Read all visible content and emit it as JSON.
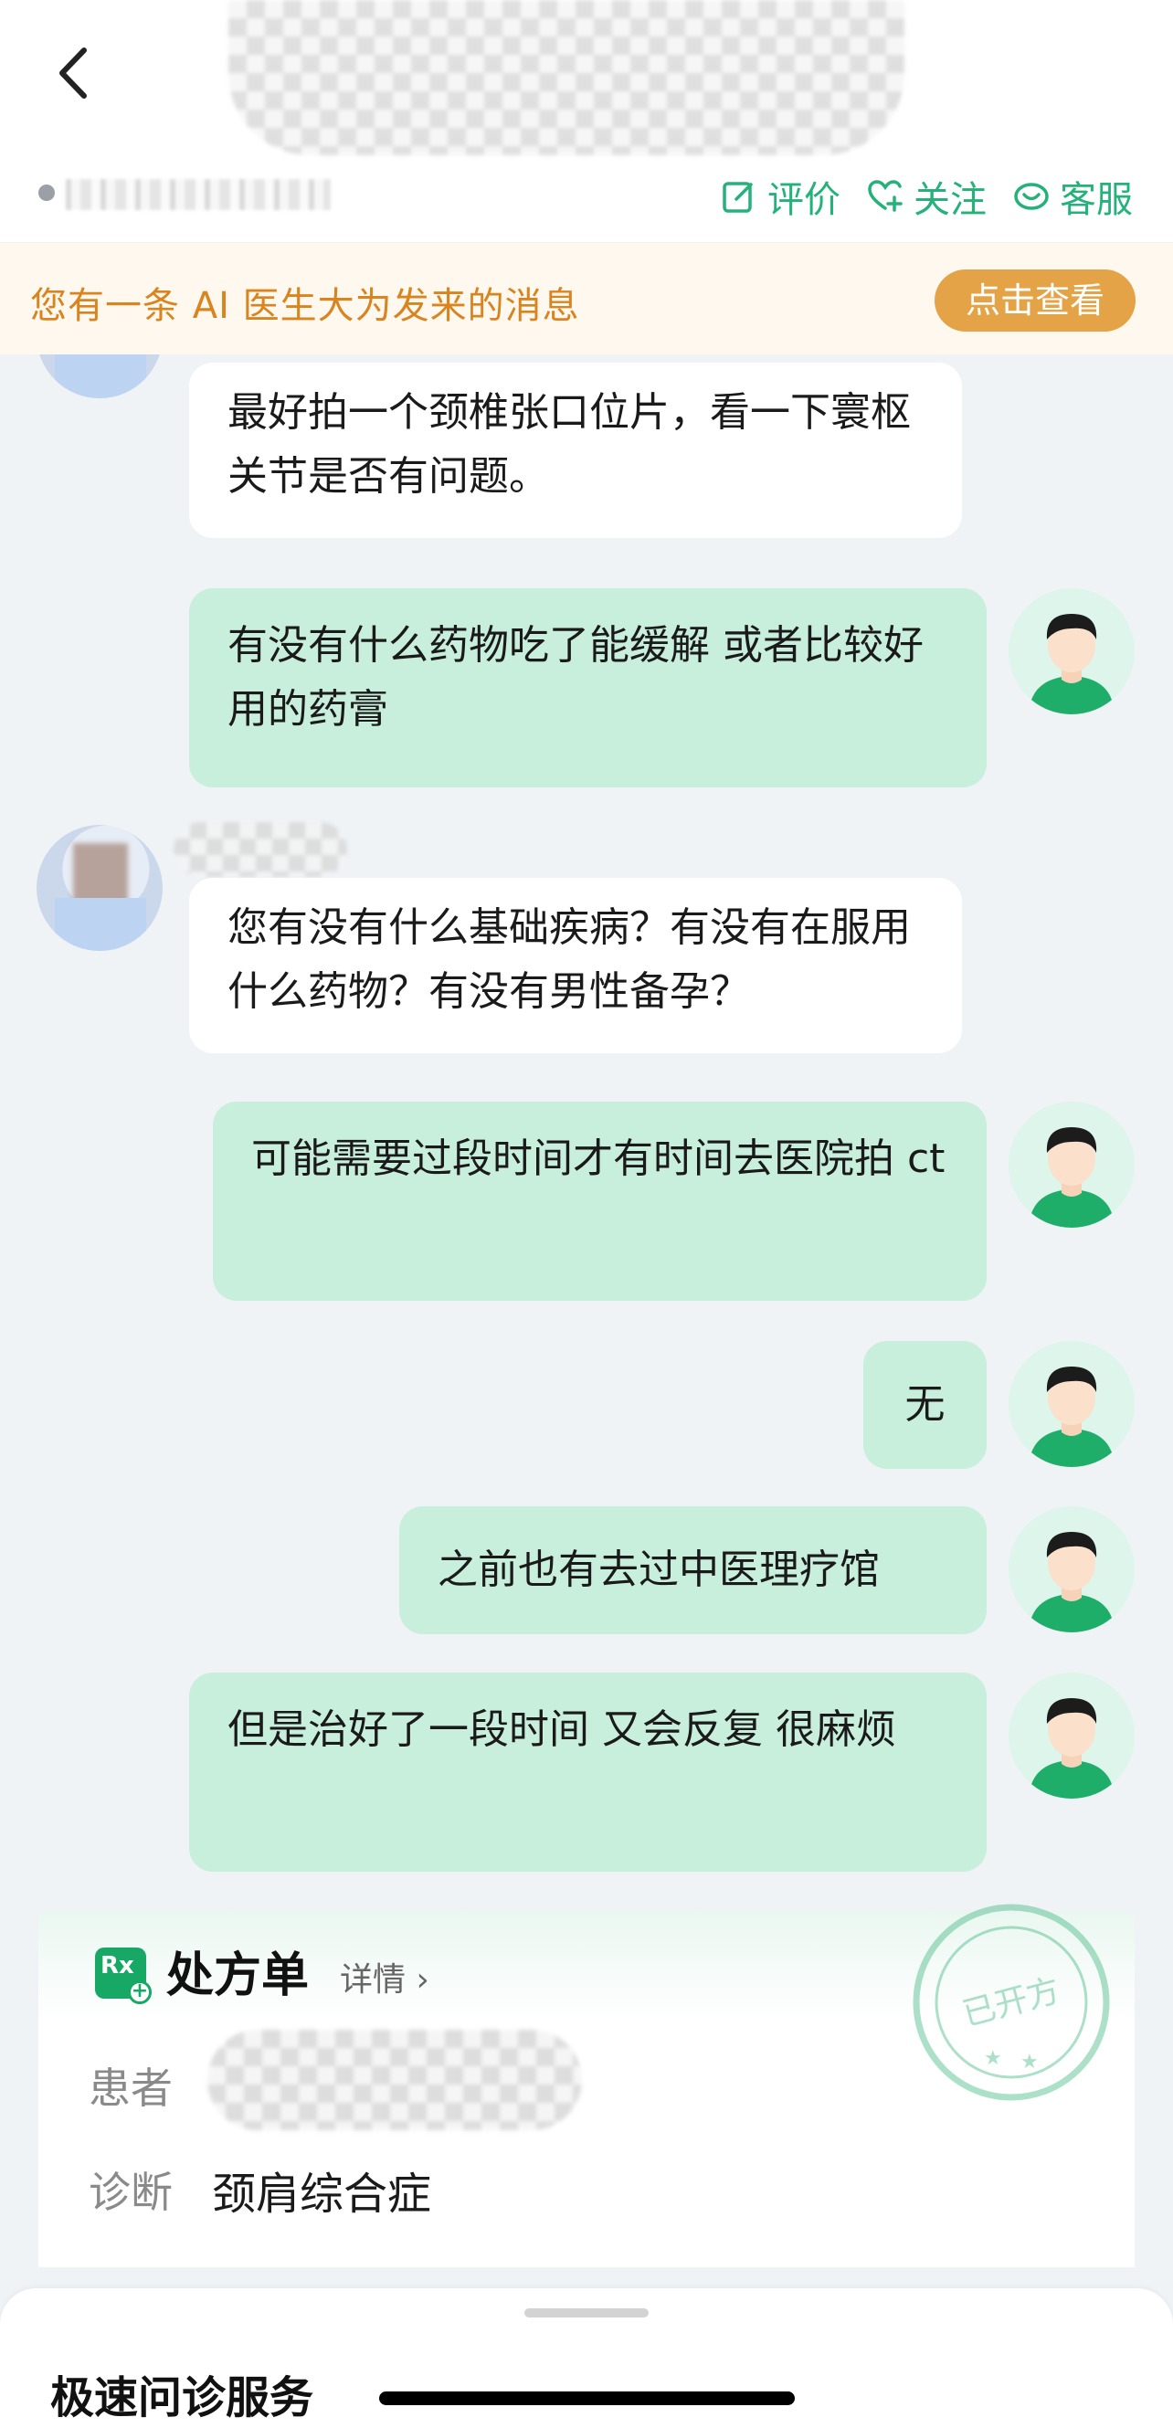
{
  "header": {
    "actions": [
      {
        "label": "评价",
        "icon": "edit-icon"
      },
      {
        "label": "关注",
        "icon": "heart-plus-icon"
      },
      {
        "label": "客服",
        "icon": "headset-icon"
      }
    ]
  },
  "notice": {
    "text": "您有一条 AI 医生大为发来的消息",
    "button": "点击查看"
  },
  "messages": [
    {
      "from": "doctor",
      "text": "最好拍一个颈椎张口位片，看一下寰枢关节是否有问题。"
    },
    {
      "from": "user",
      "text": "有没有什么药物吃了能缓解  或者比较好用的药膏"
    },
    {
      "from": "doctor",
      "text": "您有没有什么基础疾病？有没有在服用什么药物？有没有男性备孕？"
    },
    {
      "from": "user",
      "text": "可能需要过段时间才有时间去医院拍 ct"
    },
    {
      "from": "user",
      "text": "无"
    },
    {
      "from": "user",
      "text": "之前也有去过中医理疗馆"
    },
    {
      "from": "user",
      "text": "但是治好了一段时间 又会反复 很麻烦"
    }
  ],
  "prescription": {
    "title": "处方单",
    "detail": "详情 ›",
    "patient_label": "患者",
    "diagnosis_label": "诊断",
    "diagnosis": "颈肩综合症",
    "stamp_text": "已开方"
  },
  "sheet": {
    "title": "极速问诊服务"
  },
  "colors": {
    "accent": "#25b27a",
    "notice_text": "#d9841f",
    "notice_button": "#e5a347",
    "user_bubble": "#c8eedc"
  }
}
